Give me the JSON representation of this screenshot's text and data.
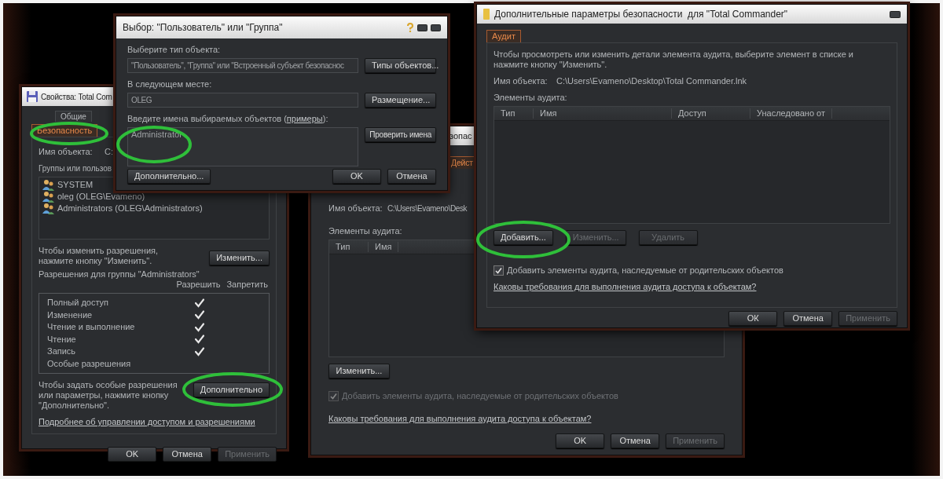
{
  "properties_window": {
    "title": "Свойства: Total Com",
    "tabs": [
      {
        "label": "Общие",
        "selected": false
      },
      {
        "label": "Безопасность",
        "selected": true
      }
    ],
    "object_label": "Имя объекта:",
    "object_value": "C:",
    "groups_label": "Группы или пользов",
    "users": [
      "SYSTEM",
      "oleg (OLEG\\Evameno)",
      "Administrators (OLEG\\Administrators)"
    ],
    "change_hint": "Чтобы изменить разрешения, нажмите кнопку \"Изменить\".",
    "change_button": "Изменить...",
    "permissions_label": "Разрешения для группы \"Administrators\"",
    "permission_columns": [
      "Разрешить",
      "Запретить"
    ],
    "permissions": [
      {
        "name": "Полный доступ",
        "allow": true,
        "deny": false
      },
      {
        "name": "Изменение",
        "allow": true,
        "deny": false
      },
      {
        "name": "Чтение и выполнение",
        "allow": true,
        "deny": false
      },
      {
        "name": "Чтение",
        "allow": true,
        "deny": false
      },
      {
        "name": "Запись",
        "allow": true,
        "deny": false
      },
      {
        "name": "Особые разрешения",
        "allow": false,
        "deny": false
      }
    ],
    "advanced_hint": "Чтобы задать особые разрешения или параметры, нажмите кнопку \"Дополнительно\".",
    "advanced_button": "Дополнительно",
    "help_link": "Подробнее об управлении доступом и разрешениями",
    "buttons": [
      {
        "label": "OK",
        "disabled": false
      },
      {
        "label": "Отмена",
        "disabled": false
      },
      {
        "label": "Применить",
        "disabled": true
      }
    ]
  },
  "audit_window": {
    "title": "зопас",
    "tabs": [
      {
        "label": "Дейст",
        "selected": true
      }
    ],
    "object_label": "Имя объекта:",
    "object_value": "C:\\Users\\Evameno\\Desk",
    "entries_label": "Элементы аудита:",
    "columns": [
      "Тип",
      "Имя"
    ],
    "edit_button": "Изменить...",
    "inherit": {
      "label": "Добавить элементы аудита, наследуемые от родительских объектов",
      "checked": true,
      "disabled": true
    },
    "help_link": "Каковы требования для выполнения аудита доступа к объектам?",
    "buttons": [
      {
        "label": "OK",
        "disabled": false
      },
      {
        "label": "Отмена",
        "disabled": false
      },
      {
        "label": "Применить",
        "disabled": true
      }
    ]
  },
  "select_dialog": {
    "title": "Выбор: \"Пользователь\" или \"Группа\"",
    "type_label": "Выберите тип объекта:",
    "type_value": "\"Пользователь\", \"Группа\" или \"Встроенный субъект безопаснос",
    "types_button": "Типы объектов...",
    "location_label": "В следующем месте:",
    "location_value": "OLEG",
    "location_button": "Размещение...",
    "names_label": {
      "before": "Введите имена выбираемых объектов (",
      "link": "примеры",
      "after": "):"
    },
    "names_value": "Administrator",
    "check_button": "Проверить имена",
    "advanced_button": "Дополнительно...",
    "buttons": [
      {
        "label": "OK",
        "disabled": false
      },
      {
        "label": "Отмена",
        "disabled": false
      }
    ]
  },
  "advanced_window": {
    "title": "Дополнительные параметры безопасности  для \"Total Commander\"",
    "tabs": [
      {
        "label": "Аудит",
        "selected": true
      }
    ],
    "hint": "Чтобы просмотреть или изменить детали элемента аудита, выберите элемент в списке и нажмите кнопку \"Изменить\".",
    "object_label": "Имя объекта:",
    "object_value": "C:\\Users\\Evameno\\Desktop\\Total Commander.lnk",
    "entries_label": "Элементы аудита:",
    "columns": [
      "Тип",
      "Имя",
      "Доступ",
      "Унаследовано от"
    ],
    "actions": [
      {
        "label": "Добавить...",
        "disabled": false
      },
      {
        "label": "Изменить...",
        "disabled": true
      },
      {
        "label": "Удалить",
        "disabled": true
      }
    ],
    "inherit": {
      "label": "Добавить элементы аудита, наследуемые от родительских объектов",
      "checked": true,
      "disabled": false
    },
    "help_link": "Каковы требования для выполнения аудита доступа к объектам?",
    "buttons": [
      {
        "label": "ОК",
        "disabled": false
      },
      {
        "label": "Отмена",
        "disabled": false
      },
      {
        "label": "Применить",
        "disabled": true
      }
    ]
  }
}
